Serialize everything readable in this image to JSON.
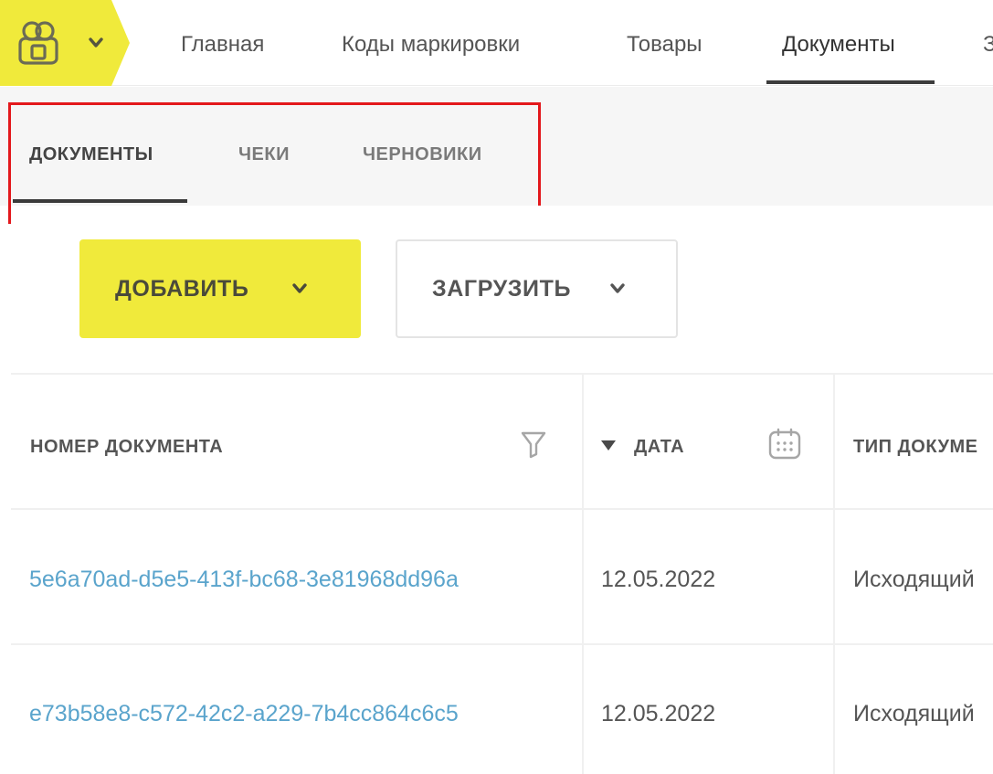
{
  "nav": {
    "items": [
      {
        "label": "Главная"
      },
      {
        "label": "Коды маркировки"
      },
      {
        "label": "Товары"
      },
      {
        "label": "Документы"
      },
      {
        "label": "З"
      }
    ]
  },
  "subtabs": [
    {
      "label": "ДОКУМЕНТЫ",
      "active": true
    },
    {
      "label": "ЧЕКИ",
      "active": false
    },
    {
      "label": "ЧЕРНОВИКИ",
      "active": false
    }
  ],
  "actions": {
    "add_label": "ДОБАВИТЬ",
    "upload_label": "ЗАГРУЗИТЬ"
  },
  "table": {
    "columns": [
      {
        "label": "НОМЕР ДОКУМЕНТА"
      },
      {
        "label": "ДАТА"
      },
      {
        "label": "ТИП ДОКУМЕ"
      }
    ],
    "rows": [
      {
        "number": "5e6a70ad-d5e5-413f-bc68-3e81968dd96a",
        "date": "12.05.2022",
        "type": "Исходящий"
      },
      {
        "number": "e73b58e8-c572-42c2-a229-7b4cc864c6c5",
        "date": "12.05.2022",
        "type": "Исходящий"
      }
    ]
  },
  "colors": {
    "accent": "#f0ea3b",
    "highlight": "#e3181c",
    "link": "#5aa4cc"
  },
  "icons": [
    "user-avatar-icon",
    "chevron-down-icon",
    "filter-icon",
    "sort-desc-icon",
    "calendar-icon"
  ]
}
